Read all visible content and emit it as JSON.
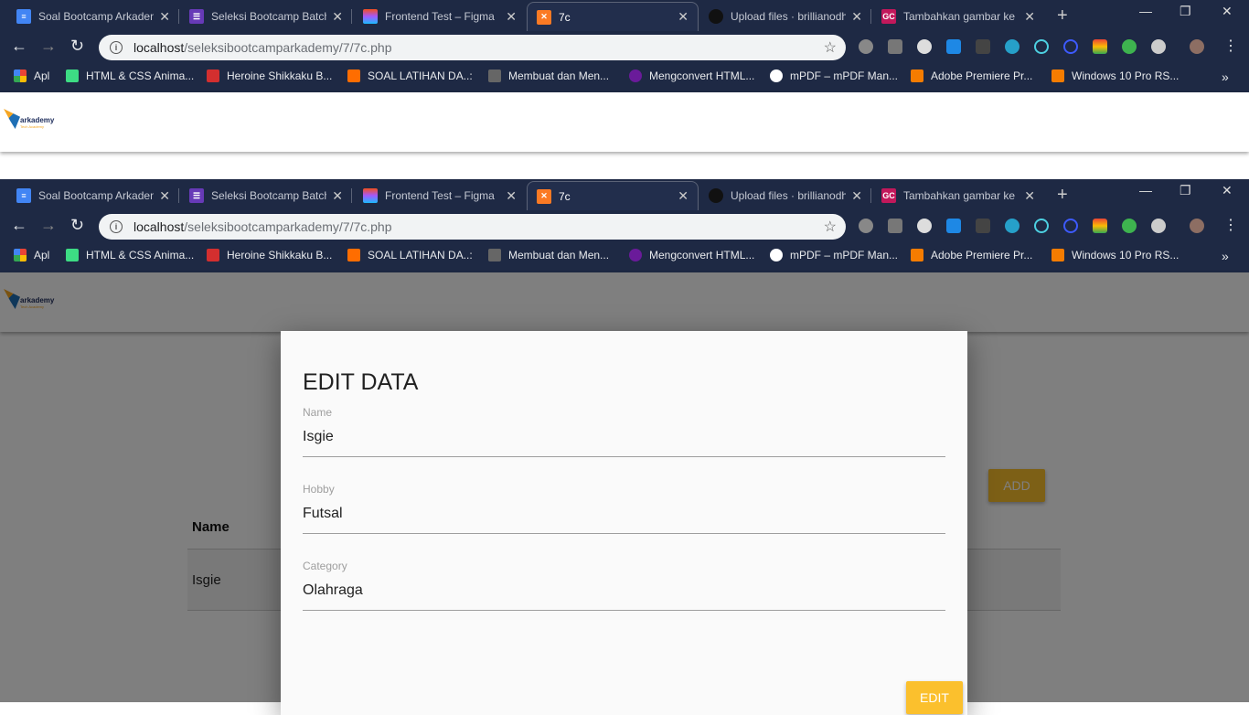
{
  "browser": {
    "tabs": [
      {
        "label": "Soal Bootcamp Arkademy",
        "icon": "google-docs-icon",
        "color": "#4285f4"
      },
      {
        "label": "Seleksi Bootcamp Batch",
        "icon": "google-forms-icon",
        "color": "#673ab7"
      },
      {
        "label": "Frontend Test – Figma",
        "icon": "figma-icon",
        "color": "#f24e1e"
      },
      {
        "label": "7c",
        "icon": "xampp-icon",
        "color": "#fb7a24"
      },
      {
        "label": "Upload files · brillianodh",
        "icon": "github-icon",
        "color": "#111111"
      },
      {
        "label": "Tambahkan gambar ke",
        "icon": "gc-icon",
        "icon_text": "GC",
        "color": "#c2185b"
      }
    ],
    "url_host": "localhost",
    "url_path": "/seleksibootcamparkademy/7/7c.php",
    "bookmarks": [
      {
        "label": "Apl",
        "color": "#ea4335"
      },
      {
        "label": "HTML & CSS Anima...",
        "color": "#3ddc84"
      },
      {
        "label": "Heroine Shikkaku B...",
        "color": "#d32f2f"
      },
      {
        "label": "SOAL LATIHAN DA..:",
        "color": "#ff6d00"
      },
      {
        "label": "Membuat dan Men...",
        "color": "#666666"
      },
      {
        "label": "Mengconvert HTML...",
        "color": "#6a1b9a"
      },
      {
        "label": "mPDF – mPDF Man...",
        "color": "#ffffff"
      },
      {
        "label": "Adobe Premiere Pr...",
        "color": "#f57c00"
      },
      {
        "label": "Windows 10 Pro RS...",
        "color": "#f57c00"
      }
    ],
    "more_bookmarks": "»"
  },
  "app": {
    "logo_text": "arkademy",
    "logo_sub": "Tech Academy",
    "add_label": "ADD",
    "table": {
      "headers": [
        "Name"
      ],
      "rows": [
        [
          "Isgie"
        ]
      ]
    },
    "accent": "#fbc02d"
  },
  "modal": {
    "title": "EDIT DATA",
    "fields": [
      {
        "label": "Name",
        "value": "Isgie"
      },
      {
        "label": "Hobby",
        "value": "Futsal"
      },
      {
        "label": "Category",
        "value": "Olahraga"
      }
    ],
    "edit_label": "EDIT"
  }
}
